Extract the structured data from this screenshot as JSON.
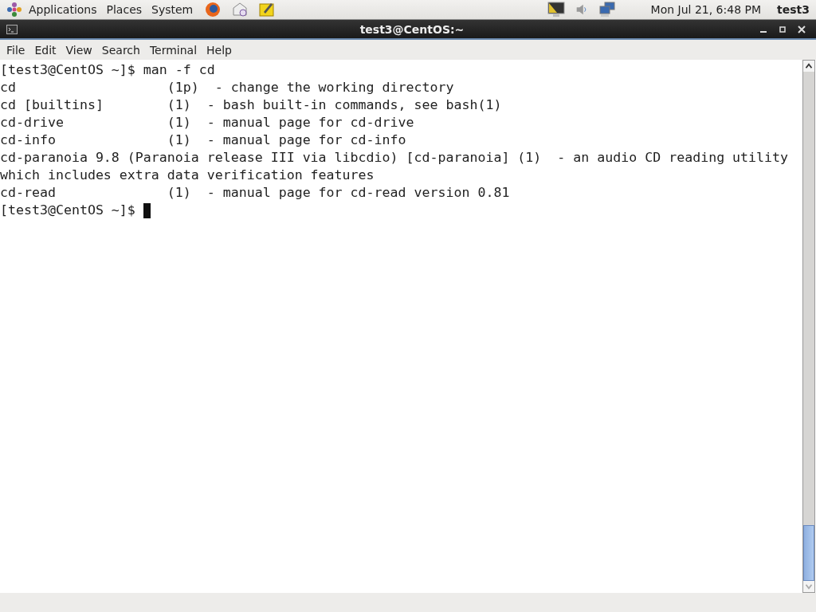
{
  "top_panel": {
    "menus": [
      "Applications",
      "Places",
      "System"
    ],
    "clock": "Mon Jul 21,  6:48 PM",
    "user": "test3"
  },
  "window": {
    "title": "test3@CentOS:~"
  },
  "menu_bar": [
    "File",
    "Edit",
    "View",
    "Search",
    "Terminal",
    "Help"
  ],
  "terminal": {
    "lines": [
      {
        "text": "[test3@CentOS ~]$ man -f cd",
        "cursor": false
      },
      {
        "text": "cd                   (1p)  - change the working directory",
        "cursor": false
      },
      {
        "text": "cd [builtins]        (1)  - bash built-in commands, see bash(1)",
        "cursor": false
      },
      {
        "text": "cd-drive             (1)  - manual page for cd-drive",
        "cursor": false
      },
      {
        "text": "cd-info              (1)  - manual page for cd-info",
        "cursor": false
      },
      {
        "text": "cd-paranoia 9.8 (Paranoia release III via libcdio) [cd-paranoia] (1)  - an audio CD reading utility",
        "cursor": false
      },
      {
        "text": "which includes extra data verification features",
        "cursor": false
      },
      {
        "text": "cd-read              (1)  - manual page for cd-read version 0.81",
        "cursor": false
      },
      {
        "text": "[test3@CentOS ~]$ ",
        "cursor": true
      }
    ]
  }
}
